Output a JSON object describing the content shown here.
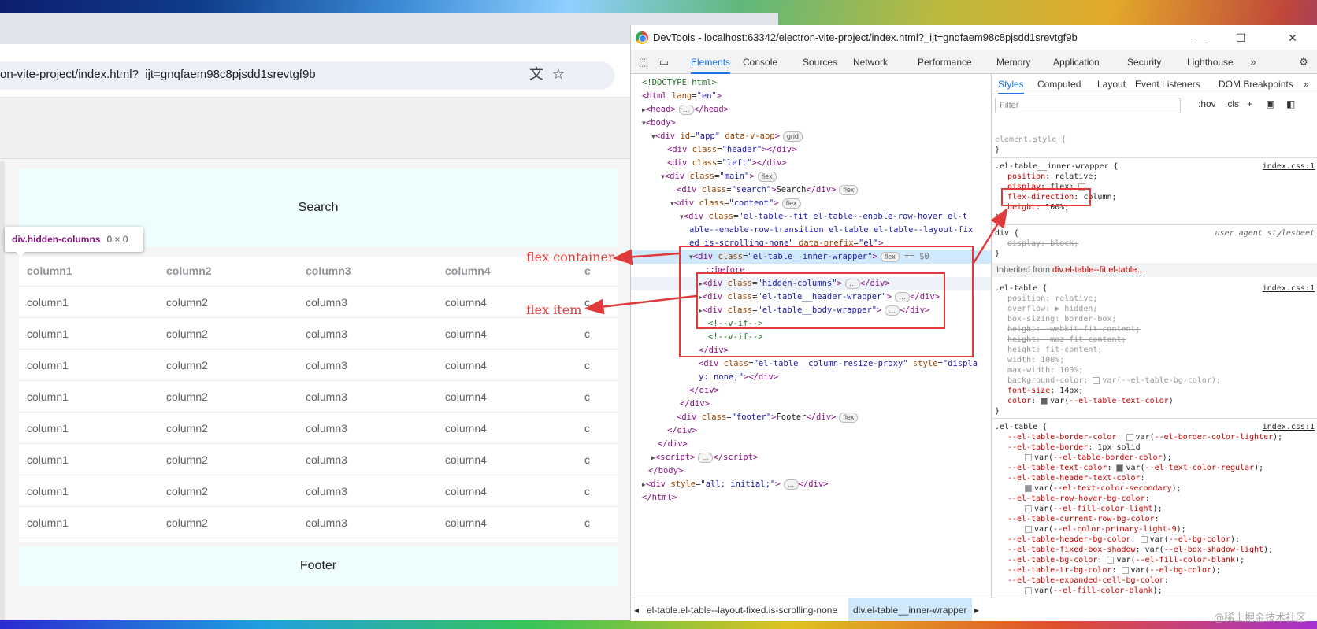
{
  "browser": {
    "url": "on-vite-project/index.html?_ijt=gnqfaem98c8pjsdd1srevtgf9b",
    "search_label": "Search",
    "footer_label": "Footer",
    "tooltip": {
      "selector": "div.hidden-columns",
      "size": "0 × 0"
    },
    "columns": [
      "column1",
      "column2",
      "column3",
      "column4",
      "c"
    ],
    "row_count": 9
  },
  "devtools": {
    "title": "DevTools - localhost:63342/electron-vite-project/index.html?_ijt=gnqfaem98c8pjsdd1srevtgf9b",
    "tabs": [
      "Elements",
      "Console",
      "Sources",
      "Network",
      "Performance",
      "Memory",
      "Application",
      "Security",
      "Lighthouse"
    ],
    "active_tab": "Elements",
    "styles_tabs": [
      "Styles",
      "Computed",
      "Layout",
      "Event Listeners",
      "DOM Breakpoints"
    ],
    "filter_placeholder": "Filter",
    "hov": ":hov",
    "cls": ".cls",
    "breadcrumb": [
      "el-table.el-table--layout-fixed.is-scrolling-none",
      "div.el-table__inner-wrapper"
    ],
    "inherited_label": "Inherited from",
    "inherited_from": "div.el-table--fit.el-table…"
  },
  "annotations": {
    "flex_container": "flex container",
    "flex_item": "flex item"
  },
  "watermark": "@稀土掘金技术社区"
}
